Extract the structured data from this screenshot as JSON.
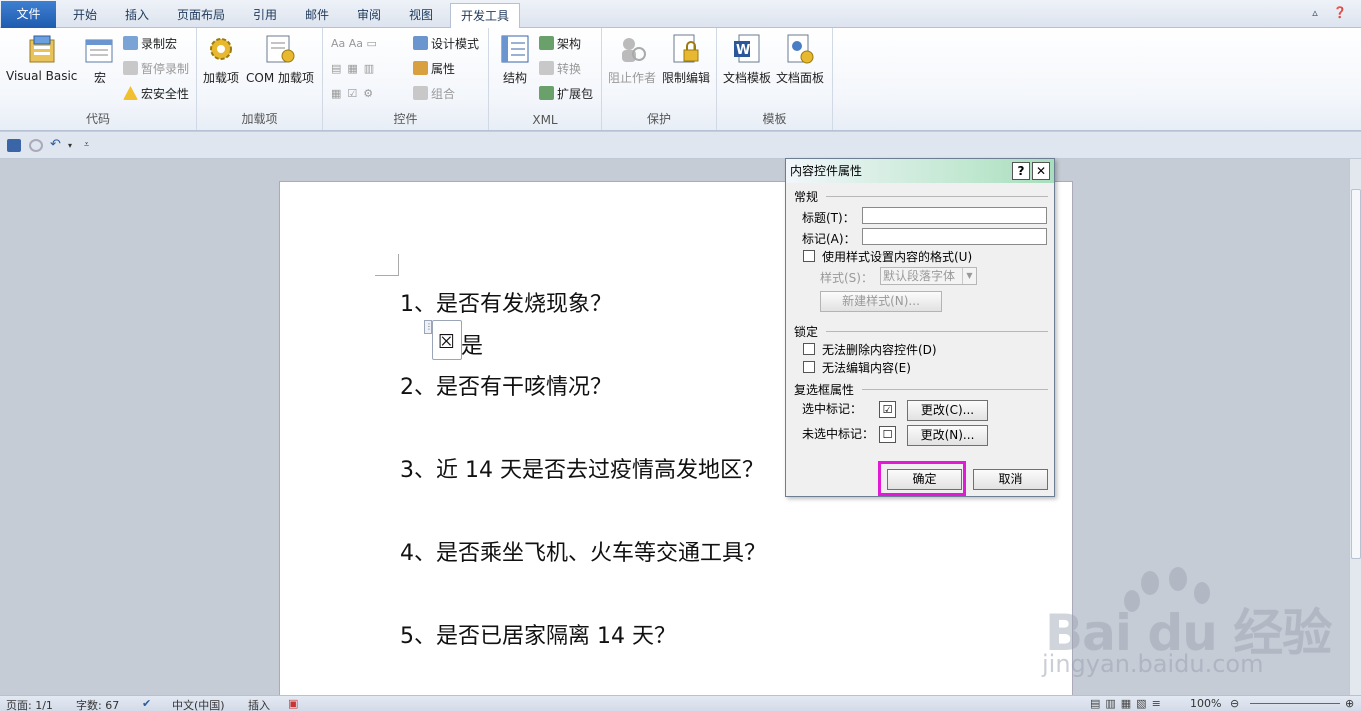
{
  "tabs": [
    "文件",
    "开始",
    "插入",
    "页面布局",
    "引用",
    "邮件",
    "审阅",
    "视图",
    "开发工具"
  ],
  "ribbon": {
    "code": {
      "label": "代码",
      "visual_basic": "Visual Basic",
      "macro": "宏",
      "record": "录制宏",
      "pause": "暂停录制",
      "security": "宏安全性"
    },
    "addins": {
      "label": "加载项",
      "addins": "加载项",
      "com": "COM 加载项"
    },
    "controls": {
      "label": "控件",
      "design": "设计模式",
      "properties": "属性",
      "group": "组合"
    },
    "xml": {
      "label": "XML",
      "structure": "结构",
      "schema": "架构",
      "transform": "转换",
      "expansion": "扩展包"
    },
    "protect": {
      "label": "保护",
      "block": "阻止作者",
      "restrict": "限制编辑"
    },
    "templates": {
      "label": "模板",
      "doc_template": "文档模板",
      "doc_panel": "文档面板"
    }
  },
  "document": {
    "q1": "1、是否有发烧现象？",
    "checkbox_symbol": "☒",
    "checkbox_label": "是",
    "q2": "2、是否有干咳情况？",
    "q3": "3、近 14 天是否去过疫情高发地区？",
    "q4": "4、是否乘坐飞机、火车等交通工具？",
    "q5": "5、是否已居家隔离 14 天？"
  },
  "dialog": {
    "title": "内容控件属性",
    "help": "?",
    "close": "✕",
    "general": "常规",
    "title_field": "标题(T)：",
    "tag_field": "标记(A)：",
    "title_value": "",
    "tag_value": "",
    "use_style": "使用样式设置内容的格式(U)",
    "style_label": "样式(S)：",
    "style_value": "默认段落字体",
    "new_style": "新建样式(N)...",
    "lock": "锁定",
    "cannot_delete": "无法删除内容控件(D)",
    "cannot_edit": "无法编辑内容(E)",
    "checkbox_props": "复选框属性",
    "checked_label": "选中标记：",
    "checked_symbol": "☑",
    "unchecked_label": "未选中标记：",
    "unchecked_symbol": "☐",
    "change_checked": "更改(C)...",
    "change_unchecked": "更改(N)...",
    "ok": "确定",
    "cancel": "取消"
  },
  "status": {
    "page": "页面: 1/1",
    "words": "字数: 67",
    "language": "中文(中国)",
    "insert": "插入",
    "zoom": "100%"
  },
  "watermark": {
    "brand": "Bai du 经验",
    "url": "jingyan.baidu.com"
  },
  "colors": {
    "accent": "#1e5bb0",
    "highlight": "#e21ad8",
    "title_gradient": "#bfe7cf"
  }
}
